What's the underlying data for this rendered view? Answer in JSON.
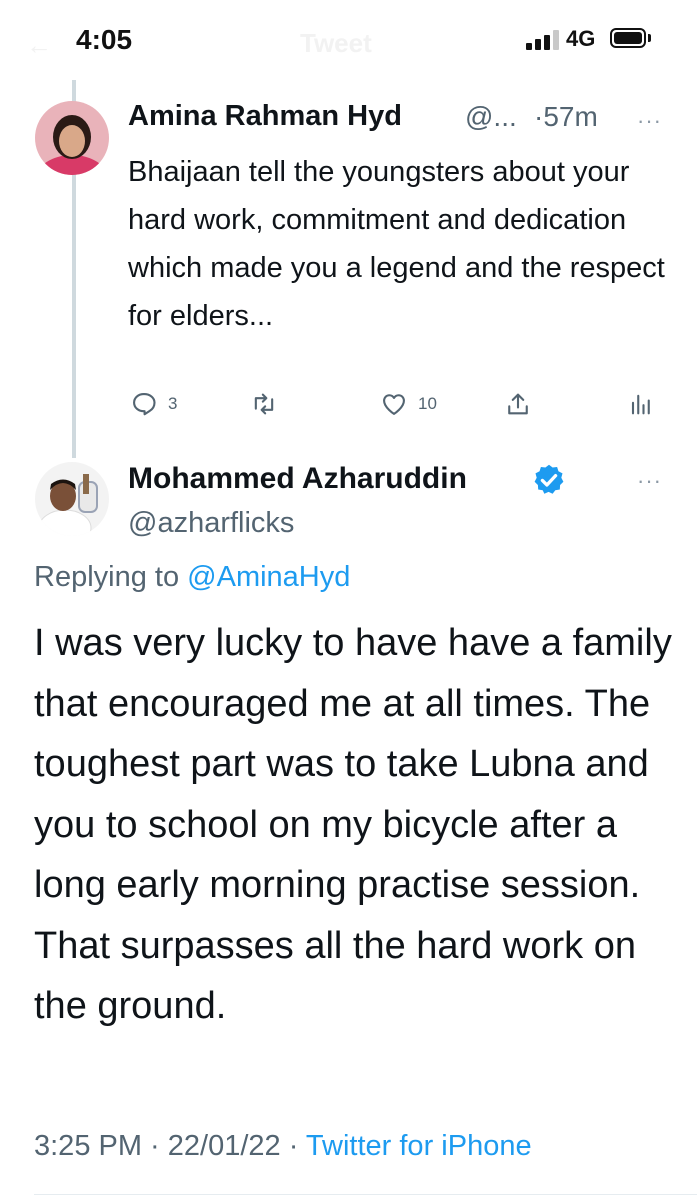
{
  "status_bar": {
    "time": "4:05",
    "network": "4G",
    "background_title": "Tweet"
  },
  "parent_tweet": {
    "author_name": "Amina Rahman Hyd",
    "handle": "@...",
    "time_ago": "·57m",
    "text": "Bhaijaan tell the youngsters about your hard work, commitment and dedication which made you a legend and the respect for elders...",
    "reply_count": "3",
    "like_count": "10",
    "more_label": "···"
  },
  "reply_tweet": {
    "author_name": "Mohammed Azharuddin",
    "handle": "@azharflicks",
    "replying_prefix": "Replying to",
    "replying_to": "@AminaHyd",
    "text": "I was very lucky to have have a family that encouraged me at all times. The toughest part was to take Lubna and you to school on my bicycle after a long early morning practise session. That surpasses all the hard work on the ground.",
    "timestamp": "3:25 PM · 22/01/22 ·",
    "source": "Twitter for iPhone",
    "more_label": "···"
  },
  "colors": {
    "accent": "#1d9bf0",
    "text": "#0f1419",
    "secondary": "#536471",
    "thread_line": "#cfd9de"
  },
  "icons": [
    "reply-icon",
    "retweet-icon",
    "like-icon",
    "share-icon",
    "analytics-icon",
    "verified-badge-icon",
    "more-icon"
  ]
}
